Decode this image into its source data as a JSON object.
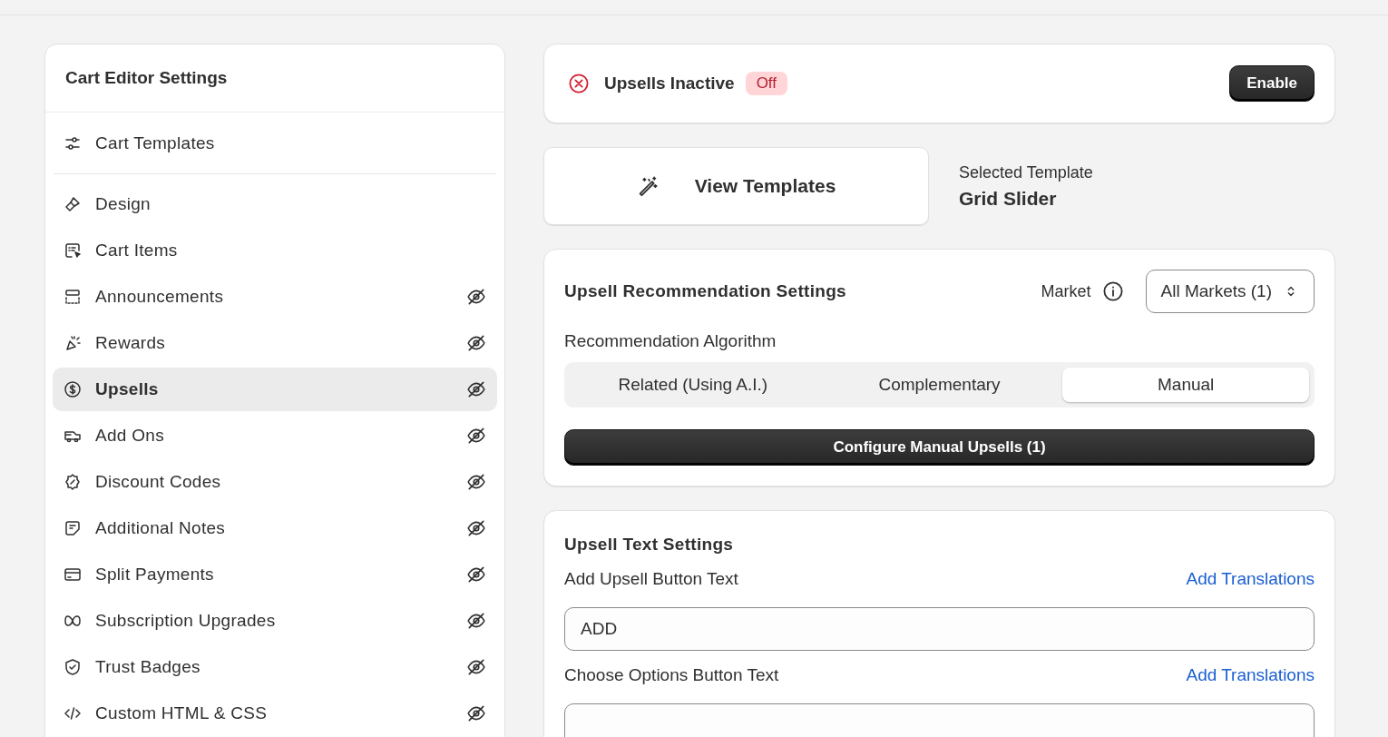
{
  "sidebar": {
    "title": "Cart Editor Settings",
    "top_item": {
      "label": "Cart Templates"
    },
    "items": [
      {
        "label": "Design",
        "selected": false,
        "hidden": false
      },
      {
        "label": "Cart Items",
        "selected": false,
        "hidden": false
      },
      {
        "label": "Announcements",
        "selected": false,
        "hidden": true
      },
      {
        "label": "Rewards",
        "selected": false,
        "hidden": true
      },
      {
        "label": "Upsells",
        "selected": true,
        "hidden": true
      },
      {
        "label": "Add Ons",
        "selected": false,
        "hidden": true
      },
      {
        "label": "Discount Codes",
        "selected": false,
        "hidden": true
      },
      {
        "label": "Additional Notes",
        "selected": false,
        "hidden": true
      },
      {
        "label": "Split Payments",
        "selected": false,
        "hidden": true
      },
      {
        "label": "Subscription Upgrades",
        "selected": false,
        "hidden": true
      },
      {
        "label": "Trust Badges",
        "selected": false,
        "hidden": true
      },
      {
        "label": "Custom HTML & CSS",
        "selected": false,
        "hidden": true
      }
    ]
  },
  "status": {
    "title": "Upsells Inactive",
    "badge": "Off",
    "active": false,
    "button": "Enable"
  },
  "templates": {
    "button": "View Templates",
    "selected_label": "Selected Template",
    "selected_value": "Grid Slider"
  },
  "recommendation": {
    "title": "Upsell Recommendation Settings",
    "market_label": "Market",
    "market_value": "All Markets (1)",
    "algorithm_label": "Recommendation Algorithm",
    "options": [
      {
        "label": "Related (Using A.I.)",
        "selected": false
      },
      {
        "label": "Complementary",
        "selected": false
      },
      {
        "label": "Manual",
        "selected": true
      }
    ],
    "configure_button": "Configure Manual Upsells (1)"
  },
  "text_settings": {
    "title": "Upsell Text Settings",
    "fields": [
      {
        "label": "Add Upsell Button Text",
        "link": "Add Translations",
        "value": "ADD"
      },
      {
        "label": "Choose Options Button Text",
        "link": "Add Translations"
      }
    ]
  }
}
